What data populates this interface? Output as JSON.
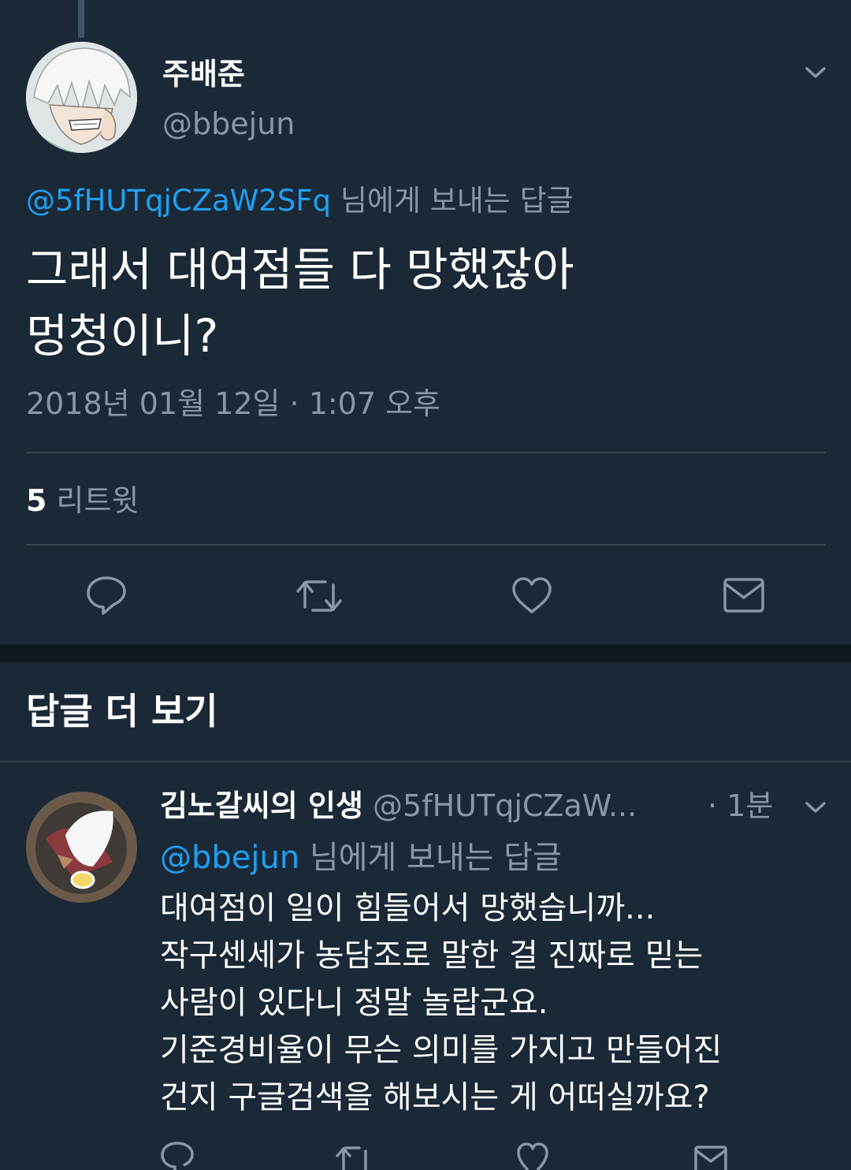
{
  "main_tweet": {
    "display_name": "주배준",
    "handle": "@bbejun",
    "reply_to_handle": "@5fHUTqjCZaW2SFq",
    "reply_suffix": "님에게 보내는 답글",
    "text_line1": "그래서 대여점들 다 망했잖아",
    "text_line2": "멍청이니?",
    "timestamp": "2018년 01월 12일 · 1:07 오후",
    "retweet_count": "5",
    "retweet_label": "리트윗"
  },
  "more_replies": {
    "title": "답글 더 보기"
  },
  "reply_tweet": {
    "display_name": "김노갈씨의 인생",
    "handle": "@5fHUTqjCZaW...",
    "time": "· 1분",
    "reply_to_handle": "@bbejun",
    "reply_suffix": "님에게 보내는 답글",
    "lines": [
      "대여점이 일이 힘들어서 망했습니까...",
      "작구센세가 농담조로 말한 걸 진짜로 믿는",
      "사람이 있다니 정말 놀랍군요.",
      "기준경비율이 무슨 의미를 가지고 만들어진",
      "건지 구글검색을 해보시는 게 어떠실까요?"
    ]
  },
  "colors": {
    "background": "#1b2836",
    "accent": "#1da1f2",
    "muted": "#8899a6",
    "divider": "#38444d"
  }
}
